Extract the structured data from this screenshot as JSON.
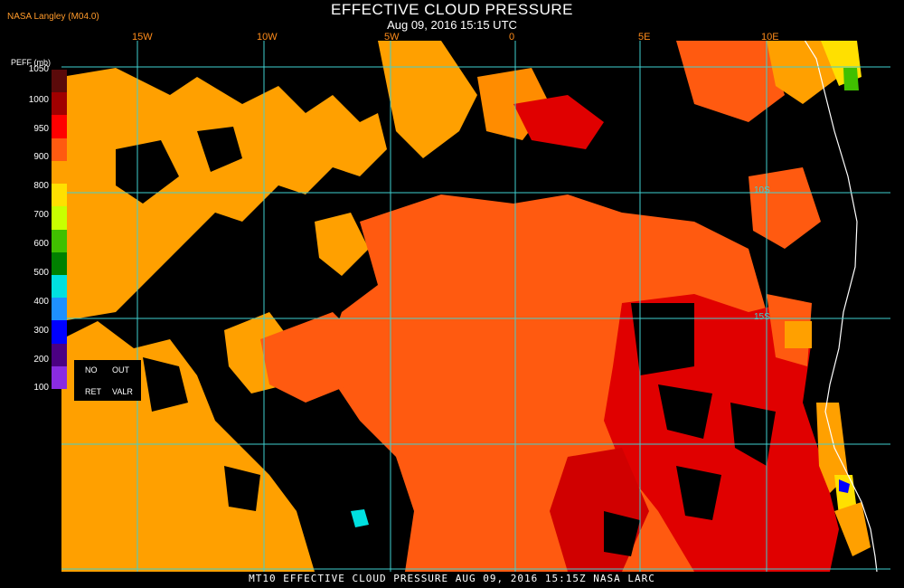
{
  "header": {
    "title": "EFFECTIVE CLOUD PRESSURE",
    "subtitle": "Aug 09, 2016 15:15 UTC",
    "credit": "NASA Langley (M04.0)"
  },
  "longitude_labels": [
    "15W",
    "10W",
    "5W",
    "0",
    "5E",
    "10E"
  ],
  "latitude_labels": [
    "10S",
    "15S"
  ],
  "legend": {
    "title": "PEFF (mb)",
    "ticks": [
      "1050",
      "1000",
      "950",
      "900",
      "800",
      "700",
      "600",
      "500",
      "400",
      "300",
      "200",
      "100"
    ],
    "colors": [
      "#5a0a0a",
      "#a00000",
      "#ff0000",
      "#ff5a10",
      "#ffa000",
      "#ffe000",
      "#c8ff00",
      "#40c000",
      "#008000",
      "#00e0e0",
      "#1e90ff",
      "#0000ff",
      "#4b0082",
      "#8a2be2"
    ]
  },
  "key": {
    "no": "NO",
    "out": "OUT",
    "ret": "RET",
    "valr": "VALR"
  },
  "footer": "MT10  EFFECTIVE CLOUD PRESSURE   AUG 09, 2016 15:15Z   NASA LARC"
}
